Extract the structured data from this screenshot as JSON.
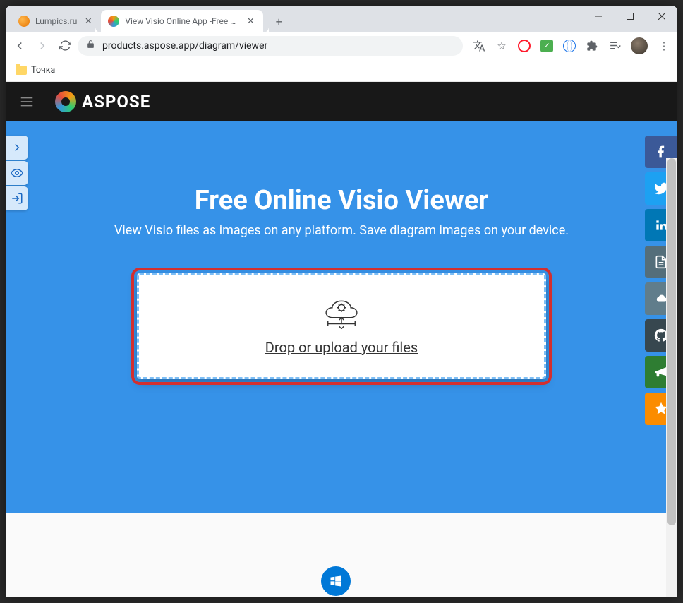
{
  "tabs": [
    {
      "title": "Lumpics.ru"
    },
    {
      "title": "View Visio Online App -Free Onli"
    }
  ],
  "url": "products.aspose.app/diagram/viewer",
  "bookmarks": {
    "item0": "Точка"
  },
  "brand": "ASPOSE",
  "hero": {
    "title": "Free Online Visio Viewer",
    "subtitle": "View Visio files as images on any platform. Save diagram images on your device."
  },
  "dropzone": {
    "text": "Drop or upload your files"
  }
}
